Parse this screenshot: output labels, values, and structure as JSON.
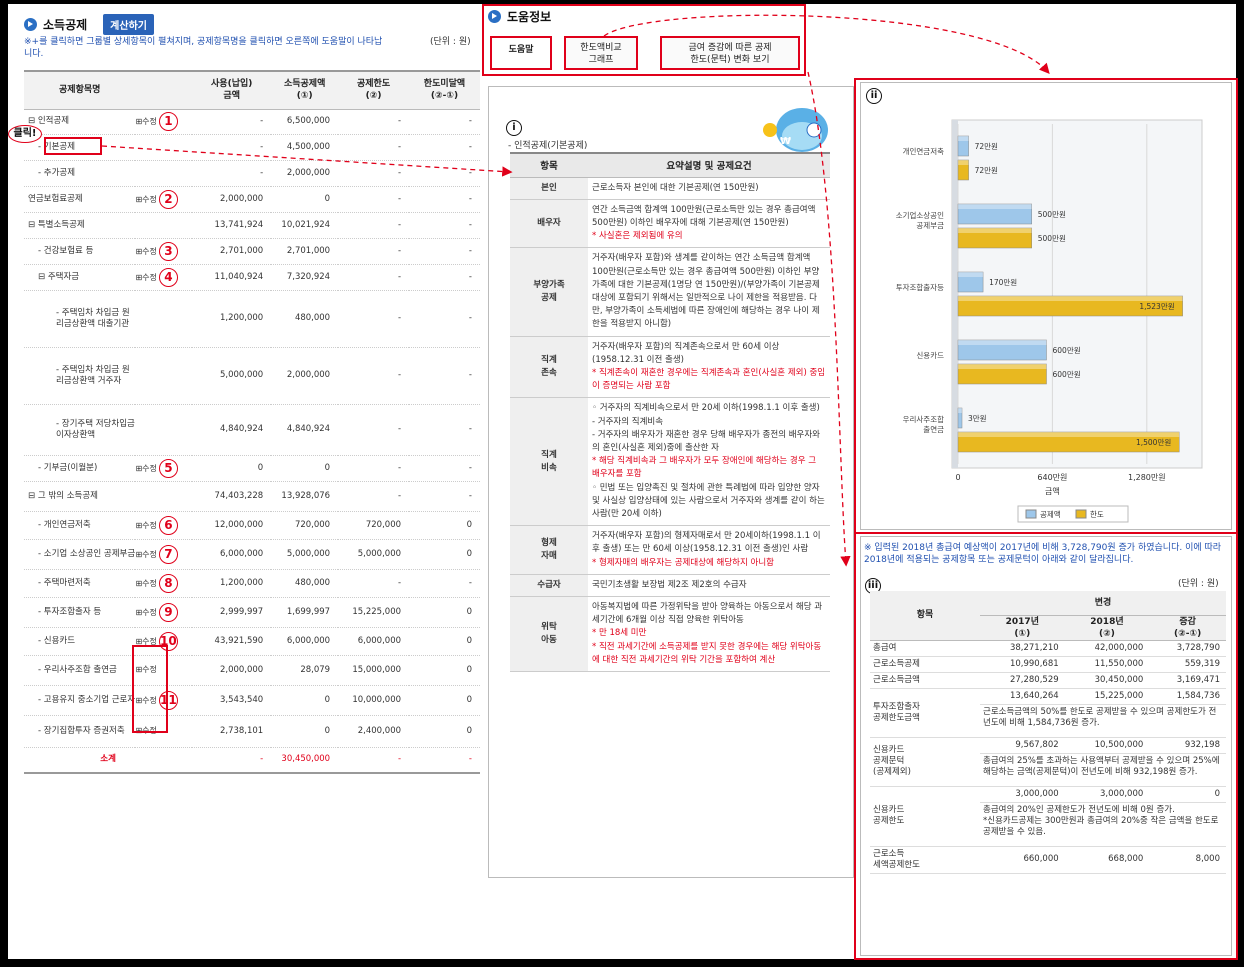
{
  "left": {
    "title": "소득공제",
    "calc_button": "계산하기",
    "notice": "※+를 클릭하면 그룹별 상세항목이 펼쳐지며, 공제항목명을 클릭하면 오른쪽에 도움말이 나타납니다.",
    "unit": "(단위 : 원)",
    "click_label": "클릭!",
    "headers": [
      "공제항목명",
      "사용(납입)\n금액",
      "소득공제액\n(①)",
      "공제한도\n(②)",
      "한도미달액\n(②-①)"
    ],
    "edit_label": "수정",
    "rows": [
      {
        "name": "⊟ 인적공제",
        "edit": true,
        "num": "1",
        "used": "-",
        "ded": "6,500,000",
        "limit": "-",
        "short": "-"
      },
      {
        "name": "- 기본공제",
        "edit": false,
        "num": "",
        "used": "-",
        "ded": "4,500,000",
        "limit": "-",
        "short": "-"
      },
      {
        "name": "- 추가공제",
        "edit": false,
        "num": "",
        "used": "-",
        "ded": "2,000,000",
        "limit": "-",
        "short": "-"
      },
      {
        "name": "연금보험료공제",
        "edit": true,
        "num": "2",
        "used": "2,000,000",
        "ded": "0",
        "limit": "-",
        "short": "-"
      },
      {
        "name": "⊟ 특별소득공제",
        "edit": false,
        "num": "",
        "used": "13,741,924",
        "ded": "10,021,924",
        "limit": "-",
        "short": "-"
      },
      {
        "name": "- 건강보험료 등",
        "edit": true,
        "num": "3",
        "used": "2,701,000",
        "ded": "2,701,000",
        "limit": "-",
        "short": "-"
      },
      {
        "name": "⊟ 주택자금",
        "edit": true,
        "num": "4",
        "used": "11,040,924",
        "ded": "7,320,924",
        "limit": "-",
        "short": "-"
      },
      {
        "name": "- 주택임차 차입금 원리금상환액 대출기관",
        "edit": false,
        "num": "",
        "used": "1,200,000",
        "ded": "480,000",
        "limit": "-",
        "short": "-"
      },
      {
        "name": "- 주택임차 차입금 원리금상환액 거주자",
        "edit": false,
        "num": "",
        "used": "5,000,000",
        "ded": "2,000,000",
        "limit": "-",
        "short": "-"
      },
      {
        "name": "- 장기주택 저당차입금 이자상환액",
        "edit": false,
        "num": "",
        "used": "4,840,924",
        "ded": "4,840,924",
        "limit": "-",
        "short": "-"
      },
      {
        "name": "- 기부금(이월분)",
        "edit": true,
        "num": "5",
        "used": "0",
        "ded": "0",
        "limit": "-",
        "short": "-"
      },
      {
        "name": "⊟ 그 밖의 소득공제",
        "edit": false,
        "num": "",
        "used": "74,403,228",
        "ded": "13,928,076",
        "limit": "-",
        "short": "-"
      },
      {
        "name": "- 개인연금저축",
        "edit": true,
        "num": "6",
        "used": "12,000,000",
        "ded": "720,000",
        "limit": "720,000",
        "short": "0"
      },
      {
        "name": "- 소기업 소상공인 공제부금",
        "edit": true,
        "num": "7",
        "used": "6,000,000",
        "ded": "5,000,000",
        "limit": "5,000,000",
        "short": "0"
      },
      {
        "name": "- 주택마련저축",
        "edit": true,
        "num": "8",
        "used": "1,200,000",
        "ded": "480,000",
        "limit": "-",
        "short": "-"
      },
      {
        "name": "- 투자조합출자 등",
        "edit": true,
        "num": "9",
        "used": "2,999,997",
        "ded": "1,699,997",
        "limit": "15,225,000",
        "short": "0"
      },
      {
        "name": "- 신용카드",
        "edit": true,
        "num": "10",
        "used": "43,921,590",
        "ded": "6,000,000",
        "limit": "6,000,000",
        "short": "0"
      },
      {
        "name": "- 우리사주조합 출연금",
        "edit": true,
        "num": "",
        "used": "2,000,000",
        "ded": "28,079",
        "limit": "15,000,000",
        "short": "0"
      },
      {
        "name": "- 고용유지 중소기업 근로자",
        "edit": true,
        "num": "11",
        "used": "3,543,540",
        "ded": "0",
        "limit": "10,000,000",
        "short": "0"
      },
      {
        "name": "- 장기집합투자 증권저축",
        "edit": true,
        "num": "",
        "used": "2,738,101",
        "ded": "0",
        "limit": "2,400,000",
        "short": "0"
      }
    ],
    "total": {
      "name": "소계",
      "used": "-",
      "ded": "30,450,000",
      "limit": "-",
      "short": "-"
    }
  },
  "middle": {
    "title": "도움정보",
    "tabs": [
      "도움말",
      "한도액비교\n그래프",
      "금여 증감에 따른 공제\n한도(문턱) 변화 보기"
    ],
    "roman": "i",
    "subtitle": "- 인적공제(기본공제)",
    "headers": [
      "항목",
      "요약설명 및 공제요건"
    ],
    "rows": [
      {
        "k": "본인",
        "lines": [
          {
            "t": "근로소득자 본인에 대한 기본공제(연 150만원)",
            "r": false
          }
        ]
      },
      {
        "k": "배우자",
        "lines": [
          {
            "t": "연간 소득금액 합계액 100만원(근로소득만 있는 경우 총급여액 500만원) 이하인 배우자에 대해 기본공제(연 150만원)",
            "r": false
          },
          {
            "t": "* 사실혼은 제외됨에 유의",
            "r": true
          }
        ]
      },
      {
        "k": "부양가족\n공제",
        "lines": [
          {
            "t": "거주자(배우자 포함)와 생계를 같이하는 연간 소득금액 합계액 100만원(근로소득만 있는 경우 총급여액 500만원) 이하인 부양가족에 대한 기본공제(1명당 연 150만원)/(부양가족이 기본공제 대상에 포함되기 위해서는 일반적으로 나이 제한을 적용받음. 다만, 부양가족이 소득세법에 따른 장애인에 해당하는 경우 나이 제한을 적용받지 아니함)",
            "r": false
          }
        ]
      },
      {
        "k": "직계\n존속",
        "lines": [
          {
            "t": "거주자(배우자 포함)의 직계존속으로서 만 60세 이상(1958.12.31 이전 출생)",
            "r": false
          },
          {
            "t": "* 직계존속이 재혼한 경우에는 직계존속과 혼인(사실혼 제외) 중임이 증명되는 사람 포함",
            "r": true
          }
        ]
      },
      {
        "k": "직계\n비속",
        "lines": [
          {
            "t": "◦ 거주자의 직계비속으로서 만 20세 이하(1998.1.1 이후 출생)",
            "r": false
          },
          {
            "t": "- 거주자의 직계비속",
            "r": false
          },
          {
            "t": "- 거주자의 배우자가 재혼한 경우 당해 배우자가 종전의 배우자와의 혼인(사실혼 제외)중에 출산한 자",
            "r": false
          },
          {
            "t": "* 해당 직계비속과 그 배우자가 모두 장애인에 해당하는 경우 그 배우자를 포함",
            "r": true
          },
          {
            "t": "◦ 민법 또는 입양촉진 및 절차에 관한 특례법에 따라 입양한 양자 및 사실상 입양상태에 있는 사람으로서 거주자와 생계를 같이 하는 사람(만 20세 이하)",
            "r": false
          }
        ]
      },
      {
        "k": "형제\n자매",
        "lines": [
          {
            "t": "거주자(배우자 포함)의 형제자매로서 만 20세이하(1998.1.1 이후 출생) 또는 만 60세 이상(1958.12.31 이전 출생)인 사람",
            "r": false
          },
          {
            "t": "* 형제자매의 배우자는 공제대상에 해당하지 아니함",
            "r": true
          }
        ]
      },
      {
        "k": "수급자",
        "lines": [
          {
            "t": "국민기초생활 보장법 제2조 제2호의 수급자",
            "r": false
          }
        ]
      },
      {
        "k": "위탁\n아동",
        "lines": [
          {
            "t": "아동복지법에 따른 가정위탁을 받아 양육하는 아동으로서 해당 과세기간에 6개월 이상 직접 양육한 위탁아동",
            "r": false
          },
          {
            "t": "* 만 18세 미만",
            "r": true
          },
          {
            "t": "* 직전 과세기간에 소득공제를 받지 못한 경우에는 해당 위탁아동에 대한 직전 과세기간의 위탁 기간을 포함하여 계산",
            "r": true
          }
        ]
      }
    ]
  },
  "chart_data": {
    "type": "bar",
    "orientation": "horizontal",
    "roman": "ii",
    "categories": [
      "개인연금저축",
      "소기업소상공인 공제부금",
      "투자조합출자등",
      "신용카드",
      "우리사주조합 출연금"
    ],
    "series": [
      {
        "name": "공제액",
        "values": [
          72,
          500,
          170,
          600,
          3
        ],
        "color": "#9ec7ea",
        "labels": [
          "72만원",
          "500만원",
          "170만원",
          "600만원",
          "3만원"
        ]
      },
      {
        "name": "한도",
        "values": [
          72,
          500,
          1523,
          600,
          1500
        ],
        "color": "#e8b820",
        "labels": [
          "72만원",
          "500만원",
          "1,523만원",
          "600만원",
          "1,500만원"
        ]
      }
    ],
    "xticks": [
      "0",
      "640만원",
      "1,280만원"
    ],
    "xlabel": "금액",
    "xlim": [
      0,
      1600
    ],
    "legend": [
      "공제액",
      "한도"
    ]
  },
  "bottom": {
    "roman": "iii",
    "notice": "※ 입력된 2018년 총급여 예상액이 2017년에 비해 3,728,790원 증가 하였습니다. 이에 따라 2018년에 적용되는 공제항목 또는 공제문턱이 아래와 같이 달라집니다.",
    "unit": "(단위 : 원)",
    "headers": {
      "item": "항목",
      "change": "변경",
      "y2017": "2017년\n(①)",
      "y2018": "2018년\n(②)",
      "diff": "증감\n(②-①)"
    },
    "rows": [
      {
        "item": "총급여",
        "a": "38,271,210",
        "b": "42,000,000",
        "c": "3,728,790",
        "note": ""
      },
      {
        "item": "근로소득공제",
        "a": "10,990,681",
        "b": "11,550,000",
        "c": "559,319",
        "note": ""
      },
      {
        "item": "근로소득금액",
        "a": "27,280,529",
        "b": "30,450,000",
        "c": "3,169,471",
        "note": ""
      },
      {
        "item": "투자조합출자\n공제한도금액",
        "a": "13,640,264",
        "b": "15,225,000",
        "c": "1,584,736",
        "note": "근로소득금액의 50%를 한도로 공제받을 수 있으며 공제한도가 전년도에 비해 1,584,736원 증가."
      },
      {
        "item": "신용카드\n공제문턱\n(공제제외)",
        "a": "9,567,802",
        "b": "10,500,000",
        "c": "932,198",
        "note": "총급여의 25%를 초과하는 사용액부터 공제받을 수 있으며 25%에 해당하는 금액(공제문턱)이 전년도에 비해 932,198원 증가."
      },
      {
        "item": "신용카드\n공제한도",
        "a": "3,000,000",
        "b": "3,000,000",
        "c": "0",
        "note": "총급여의 20%인 공제한도가 전년도에 비해 0원 증가.\n*신용카드공제는 300만원과 총급여의 20%중 작은 금액을 한도로 공제받을 수 있음."
      },
      {
        "item": "근로소득\n세액공제한도",
        "a": "660,000",
        "b": "668,000",
        "c": "8,000",
        "note": ""
      }
    ]
  }
}
